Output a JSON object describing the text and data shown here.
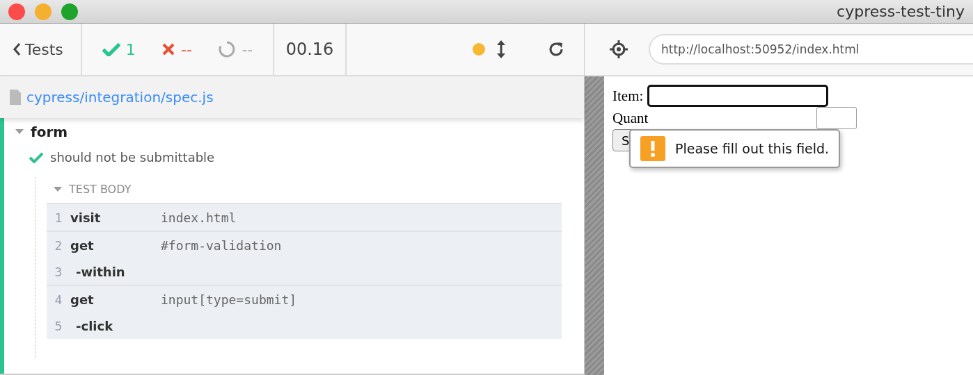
{
  "window": {
    "title": "cypress-test-tiny"
  },
  "header": {
    "back_label": "Tests",
    "passed": "1",
    "failed": "--",
    "pending": "--",
    "duration": "00.16"
  },
  "spec": {
    "path": "cypress/integration/spec.js"
  },
  "suite": {
    "title": "form",
    "test": {
      "title": "should not be submittable",
      "section": {
        "title": "TEST BODY"
      },
      "command_groups": [
        [
          {
            "number": "1",
            "name": "visit",
            "message": "index.html",
            "child": false
          }
        ],
        [
          {
            "number": "2",
            "name": "get",
            "message": "#form-validation",
            "child": false
          },
          {
            "number": "3",
            "name": "-within",
            "child": true
          }
        ],
        [
          {
            "number": "4",
            "name": "get",
            "message": "input[type=submit]",
            "child": false
          },
          {
            "number": "5",
            "name": "-click",
            "child": true
          }
        ]
      ]
    }
  },
  "url": {
    "value": "http://localhost:50952/index.html"
  },
  "app": {
    "item_label": "Item:",
    "quantity_label": "Quant",
    "submit_label": "S",
    "tooltip": "Please fill out this field."
  }
}
